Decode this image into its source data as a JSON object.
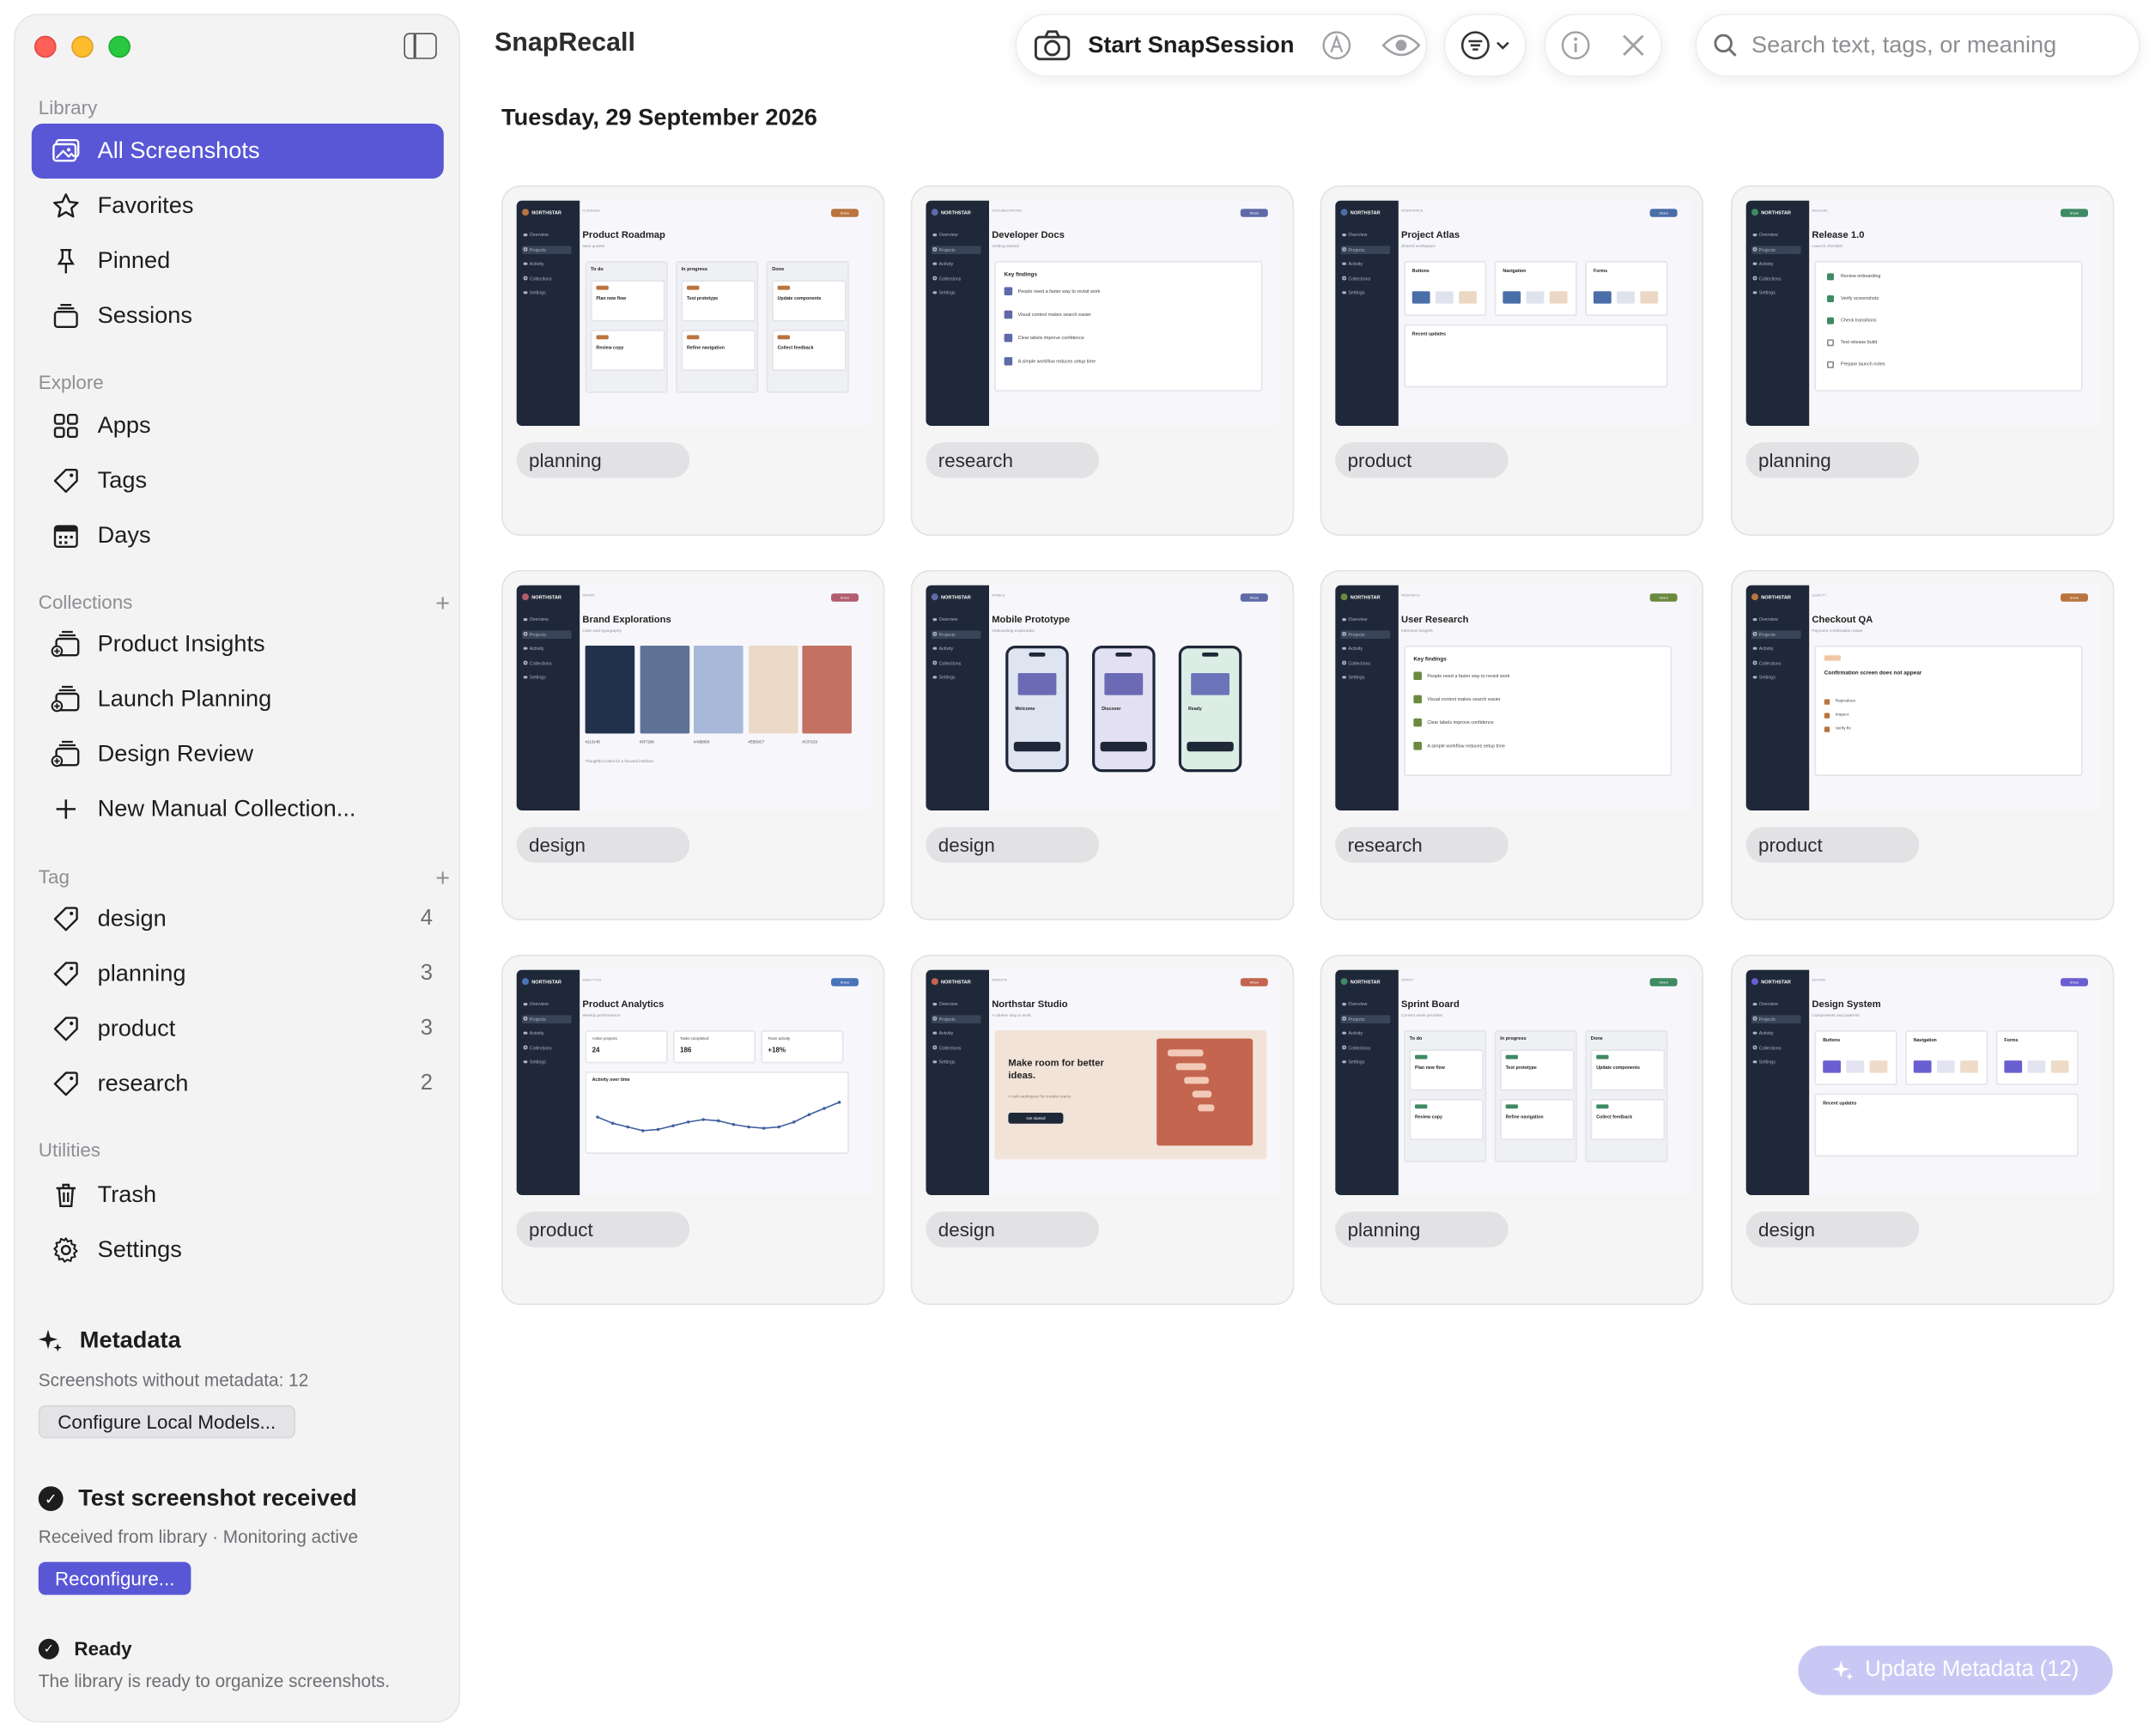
{
  "app": {
    "title": "SnapRecall"
  },
  "toolbar": {
    "start_session": "Start SnapSession",
    "search_placeholder": "Search text, tags, or meaning"
  },
  "date_heading": "Tuesday, 29 September 2026",
  "sidebar": {
    "library_label": "Library",
    "library": [
      {
        "label": "All Screenshots",
        "icon": "photos-icon",
        "active": true
      },
      {
        "label": "Favorites",
        "icon": "star-icon"
      },
      {
        "label": "Pinned",
        "icon": "pin-icon"
      },
      {
        "label": "Sessions",
        "icon": "stack-icon"
      }
    ],
    "explore_label": "Explore",
    "explore": [
      {
        "label": "Apps",
        "icon": "grid-icon"
      },
      {
        "label": "Tags",
        "icon": "tag-icon"
      },
      {
        "label": "Days",
        "icon": "calendar-icon"
      }
    ],
    "collections_label": "Collections",
    "collections": [
      {
        "label": "Product Insights",
        "icon": "collection-icon"
      },
      {
        "label": "Launch Planning",
        "icon": "collection-icon"
      },
      {
        "label": "Design Review",
        "icon": "collection-icon"
      },
      {
        "label": "New Manual Collection...",
        "icon": "plus-icon"
      }
    ],
    "tag_label": "Tag",
    "tags": [
      {
        "label": "design",
        "count": "4"
      },
      {
        "label": "planning",
        "count": "3"
      },
      {
        "label": "product",
        "count": "3"
      },
      {
        "label": "research",
        "count": "2"
      }
    ],
    "utilities_label": "Utilities",
    "utilities": [
      {
        "label": "Trash",
        "icon": "trash-icon"
      },
      {
        "label": "Settings",
        "icon": "gear-icon"
      }
    ],
    "metadata": {
      "title": "Metadata",
      "subtitle": "Screenshots without metadata: 12",
      "button": "Configure Local Models..."
    },
    "test_status": {
      "title": "Test screenshot received",
      "subtitle": "Received from library · Monitoring active",
      "button": "Reconfigure..."
    },
    "ready_status": {
      "title": "Ready",
      "subtitle": "The library is ready to organize screenshots."
    }
  },
  "thumb_common": {
    "brand": "NORTHSTAR",
    "nav": [
      "Overview",
      "Projects",
      "Activity",
      "Collections",
      "Settings"
    ],
    "badge": "Share"
  },
  "cards": [
    {
      "tag": "planning",
      "kind": "board",
      "title": "Product Roadmap",
      "eyebrow": "PLANNING",
      "sub": "Next quarter",
      "accent": "#b9743f",
      "columns": [
        "To do",
        "In progress",
        "Done"
      ],
      "items": [
        "Plan new flow",
        "Test prototype",
        "Update components",
        "Review copy",
        "Refine navigation",
        "Collect feedback"
      ]
    },
    {
      "tag": "research",
      "kind": "findings",
      "title": "Developer Docs",
      "eyebrow": "DOCUMENTATION",
      "sub": "Getting started",
      "accent": "#5f6aa8",
      "heading": "Key findings",
      "items": [
        "People need a faster way to revisit work",
        "Visual context makes search easier",
        "Clear labels improve confidence",
        "A simple workflow reduces setup time"
      ]
    },
    {
      "tag": "product",
      "kind": "components",
      "title": "Project Atlas",
      "eyebrow": "WORKSPACE",
      "sub": "Shared workspace",
      "accent": "#4a6ea8",
      "cols": [
        "Buttons",
        "Navigation",
        "Forms"
      ],
      "updates": "Recent updates",
      "swatches": [
        "#4a6ea8",
        "#dfe3ee",
        "#ecd7c4"
      ]
    },
    {
      "tag": "planning",
      "kind": "checklist",
      "title": "Release 1.0",
      "eyebrow": "RELEASE",
      "sub": "Launch checklist",
      "accent": "#3f8a63",
      "items": [
        "Review onboarding",
        "Verify screenshots",
        "Check transitions",
        "Test release build",
        "Prepare launch notes"
      ]
    },
    {
      "tag": "design",
      "kind": "palette",
      "title": "Brand Explorations",
      "eyebrow": "BRAND",
      "sub": "Calm and typography",
      "accent": "#b25c6e",
      "colors": [
        "#21314B",
        "#5F7296",
        "#A8B8D9",
        "#EBD9C7",
        "#C37163"
      ],
      "labels": [
        "#21314B",
        "#5F7296",
        "#A8B8D9",
        "#EBD9C7",
        "#C37163"
      ],
      "caption": "Thoughtful colors for a focused interface"
    },
    {
      "tag": "design",
      "kind": "phones",
      "title": "Mobile Prototype",
      "eyebrow": "MOBILE",
      "sub": "Onboarding exploration",
      "accent": "#5f6aa8",
      "screens": [
        "Welcome",
        "Discover",
        "Ready"
      ],
      "tints": [
        "#dfe4f1",
        "#e4e0f3",
        "#dcede5"
      ]
    },
    {
      "tag": "research",
      "kind": "findings",
      "title": "User Research",
      "eyebrow": "RESEARCH",
      "sub": "Interview insights",
      "accent": "#6b8a3f",
      "heading": "Key findings",
      "items": [
        "People need a faster way to revisit work",
        "Visual context makes search easier",
        "Clear labels improve confidence",
        "A simple workflow reduces setup time"
      ]
    },
    {
      "tag": "product",
      "kind": "qa",
      "title": "Checkout QA",
      "eyebrow": "QUALITY",
      "sub": "Payment confirmation issue",
      "accent": "#b9743f",
      "issue": "Confirmation screen does not appear",
      "steps": [
        "Reproduce",
        "Inspect",
        "Verify fix"
      ]
    },
    {
      "tag": "product",
      "kind": "analytics",
      "title": "Product Analytics",
      "eyebrow": "ANALYTICS",
      "sub": "Weekly performance",
      "accent": "#4a74b8",
      "stats": [
        {
          "label": "Active projects",
          "value": "24"
        },
        {
          "label": "Tasks completed",
          "value": "186"
        },
        {
          "label": "Team activity",
          "value": "+18%"
        }
      ],
      "chart_title": "Activity over time",
      "series": [
        52,
        47,
        44,
        41,
        42,
        45,
        48,
        50,
        49,
        46,
        44,
        43,
        44,
        48,
        54,
        59,
        64
      ]
    },
    {
      "tag": "design",
      "kind": "hero",
      "title": "Northstar Studio",
      "eyebrow": "WEBSITE",
      "sub": "A clearer way to work",
      "accent": "#c4654f",
      "headline": "Make room for better ideas.",
      "body": "A calm workspace for creative teams",
      "cta": "Get started"
    },
    {
      "tag": "planning",
      "kind": "board",
      "title": "Sprint Board",
      "eyebrow": "SPRINT",
      "sub": "Current week priorities",
      "accent": "#3f8a63",
      "columns": [
        "To do",
        "In progress",
        "Done"
      ],
      "items": [
        "Plan new flow",
        "Test prototype",
        "Update components",
        "Review copy",
        "Refine navigation",
        "Collect feedback"
      ]
    },
    {
      "tag": "design",
      "kind": "components",
      "title": "Design System",
      "eyebrow": "DESIGN",
      "sub": "Components and patterns",
      "accent": "#6a5fd0",
      "cols": [
        "Buttons",
        "Navigation",
        "Forms"
      ],
      "updates": "Recent updates",
      "swatches": [
        "#6a5fd0",
        "#e4e3f2",
        "#efdcc8"
      ]
    }
  ],
  "update_button": "Update Metadata (12)"
}
